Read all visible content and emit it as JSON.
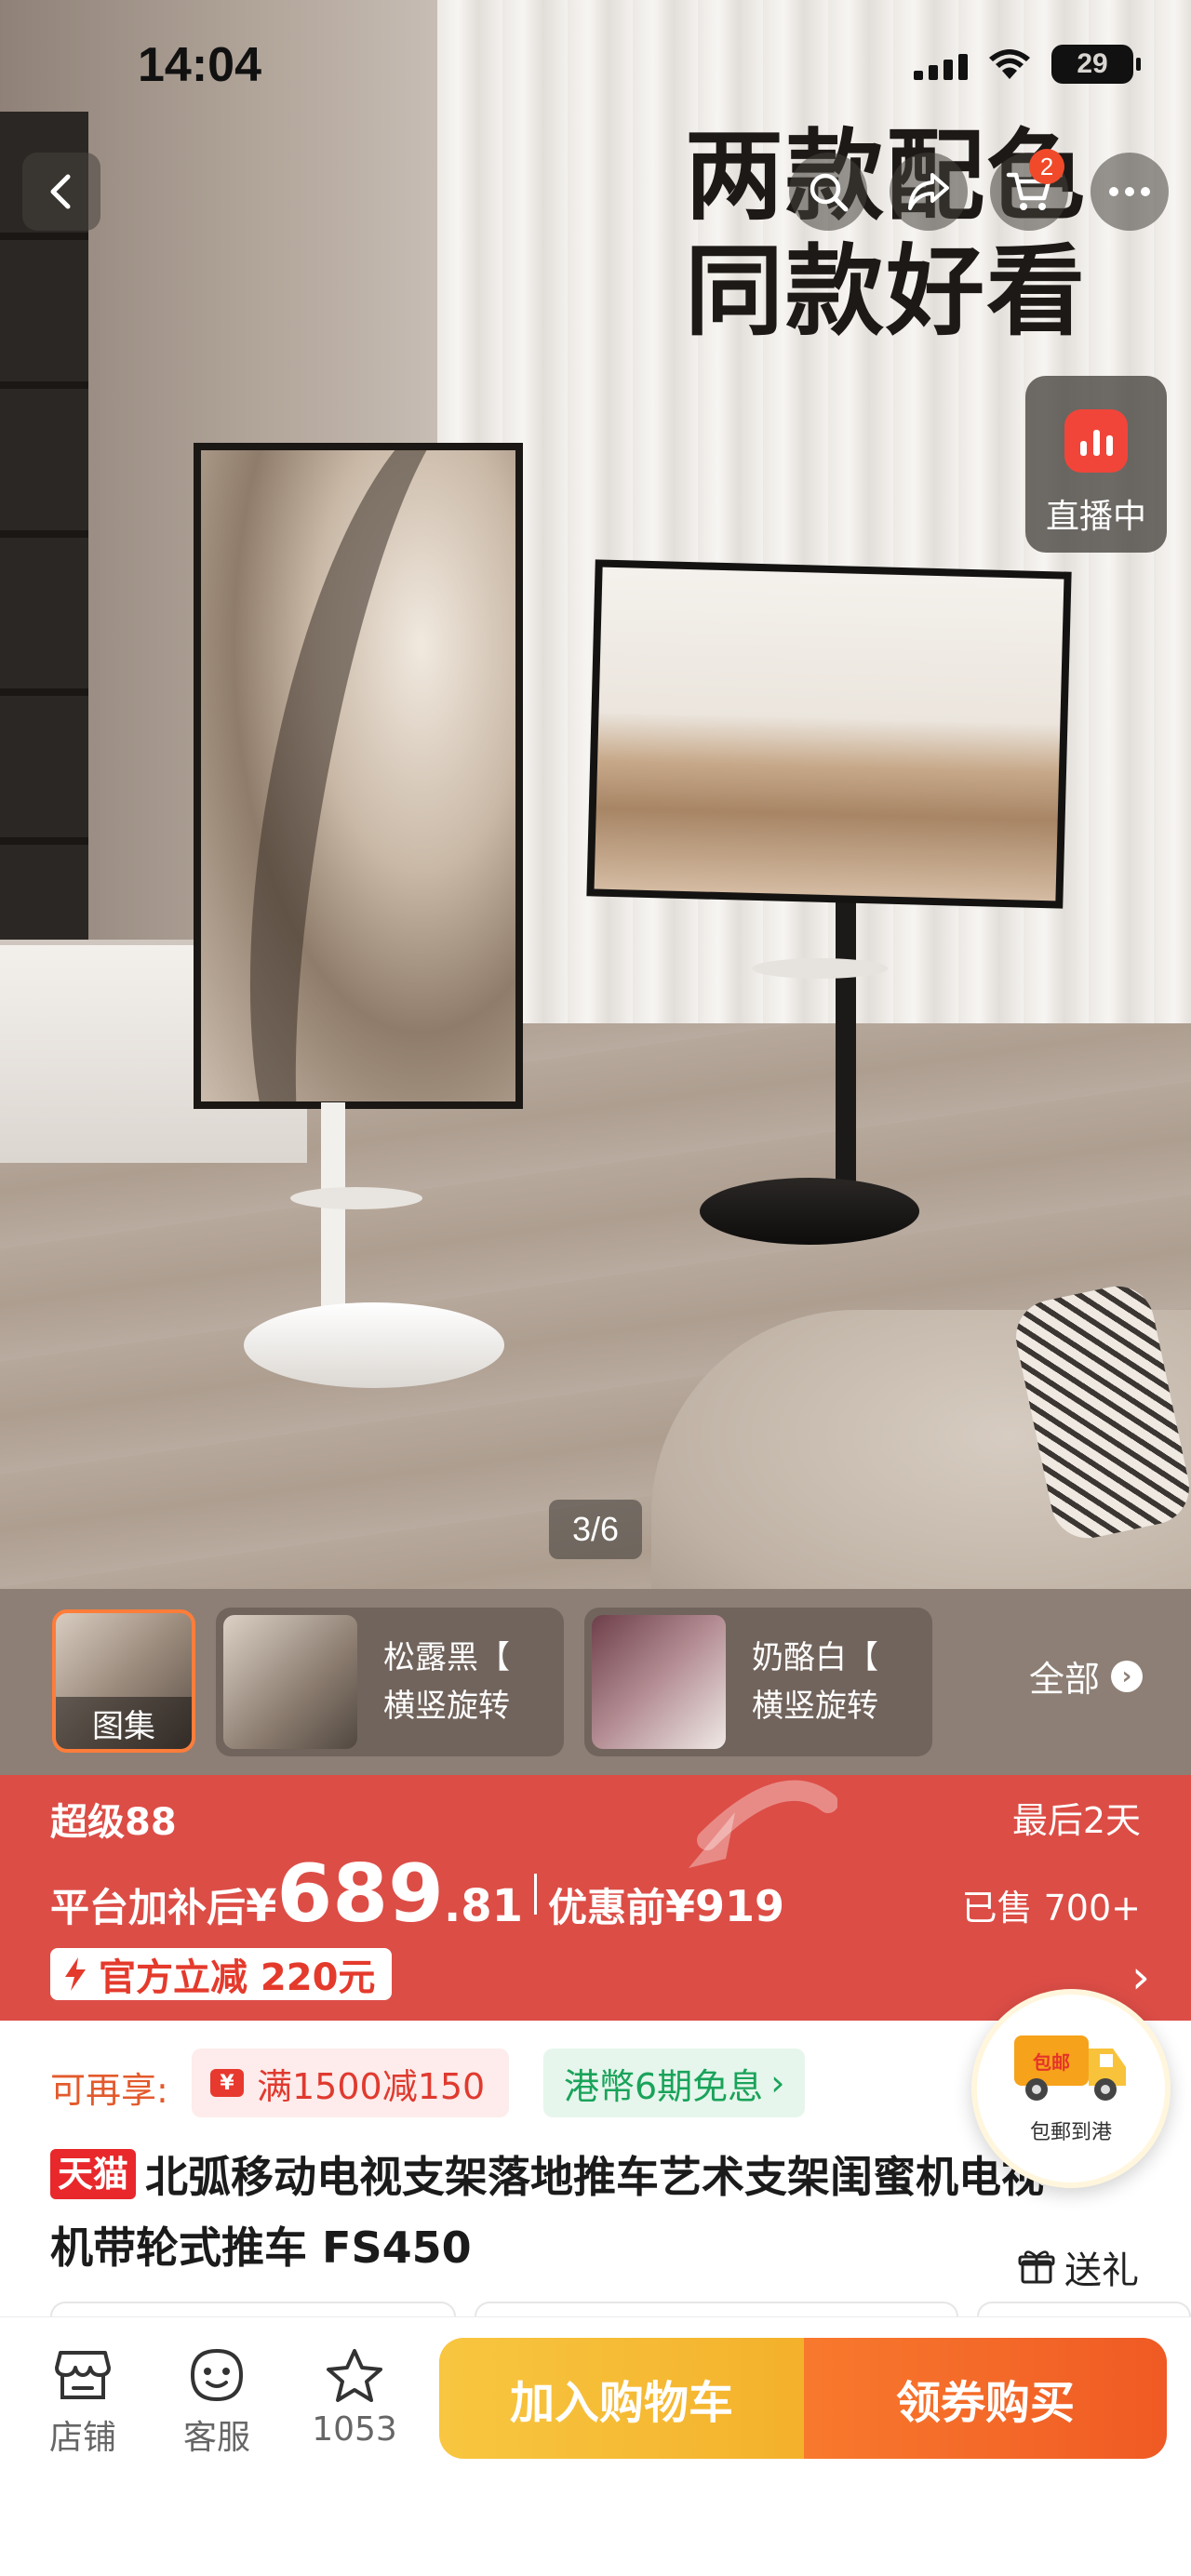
{
  "status_bar": {
    "time": "14:04",
    "battery": "29"
  },
  "nav": {
    "cart_badge": "2"
  },
  "hero": {
    "headline_line1": "两款配色",
    "headline_line2": "同款好看",
    "live_label": "直播中",
    "page_indicator": "3/6",
    "icons": [
      "back-icon",
      "search-icon",
      "share-icon",
      "cart-icon",
      "more-icon",
      "live-icon"
    ]
  },
  "thumbnails": {
    "gallery_label": "图集",
    "variants": [
      {
        "line1": "松露黑【",
        "line2": "横竖旋转"
      },
      {
        "line1": "奶酪白【",
        "line2": "横竖旋转"
      }
    ],
    "all_label": "全部"
  },
  "price_banner": {
    "promo_name": "超级88",
    "countdown": "最后2天",
    "price_prefix": "平台加补后",
    "currency": "¥",
    "price_integer": "689",
    "price_decimal": ".81",
    "original_label": "优惠前",
    "original_price": "¥919",
    "sold": "已售 700+",
    "discount": "官方立减 220元",
    "colors": {
      "banner": "#dc4d46",
      "discount_text": "#e43a2c"
    }
  },
  "details": {
    "enjoy_label": "可再享:",
    "coupon_tag": "满1500减150",
    "hk_tag": "港幣6期免息",
    "platform_badge": "天猫",
    "title": "北弧移动电视支架落地推车艺术支架闺蜜机电视机带轮式推车 FS450",
    "gift_label": "送礼",
    "free_ship_badge": "包邮",
    "free_ship_caption": "包郵到港"
  },
  "bottom_bar": {
    "store_label": "店铺",
    "service_label": "客服",
    "favorites_count": "1053",
    "add_to_cart": "加入购物车",
    "buy_now": "领券购买",
    "colors": {
      "cart_button": "#f4b12b",
      "buy_button": "#f05a24"
    }
  }
}
